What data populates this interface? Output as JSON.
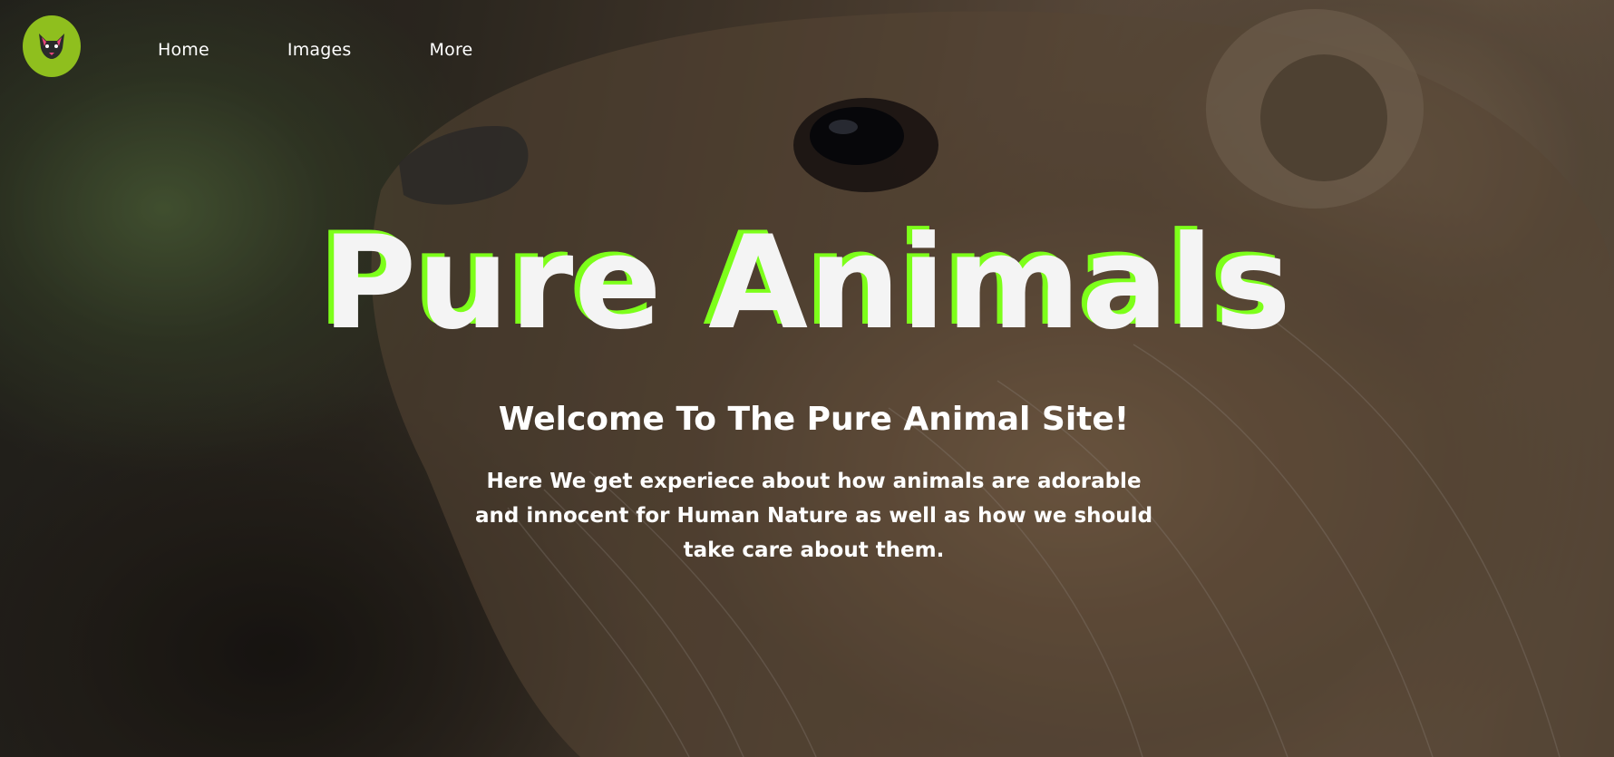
{
  "nav": {
    "logo_icon": "fox-logo-icon",
    "links": [
      {
        "label": "Home"
      },
      {
        "label": "Images"
      },
      {
        "label": "More"
      }
    ]
  },
  "hero": {
    "title": "Pure Animals",
    "subtitle": "Welcome To The Pure Animal Site!",
    "description": "Here We get experiece about how animals are adorable and innocent for Human Nature as well as how we should take care about them.",
    "background_image": "marmot-closeup-photo"
  },
  "colors": {
    "accent": "#7dff1a",
    "logo_bg": "#8fbf1e",
    "text": "#ffffff"
  }
}
